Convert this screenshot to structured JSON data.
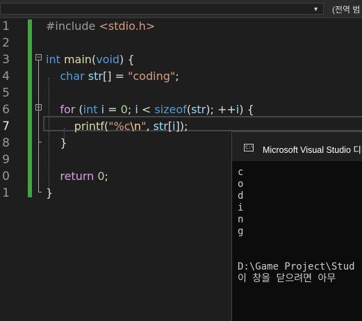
{
  "toolbar": {
    "scope_dropdown_value": "",
    "member_scope_label": "(전역 범"
  },
  "editor": {
    "line_numbers": [
      "1",
      "2",
      "3",
      "4",
      "5",
      "6",
      "7",
      "8",
      "9",
      "0",
      "1"
    ],
    "active_line_index": 6,
    "lines": [
      {
        "tokens": [
          {
            "t": "#include ",
            "c": "pre"
          },
          {
            "t": "<stdio.h>",
            "c": "str"
          }
        ]
      },
      {
        "tokens": []
      },
      {
        "tokens": [
          {
            "t": "int",
            "c": "kw"
          },
          {
            "t": " ",
            "c": "op"
          },
          {
            "t": "main",
            "c": "fn"
          },
          {
            "t": "(",
            "c": "op"
          },
          {
            "t": "void",
            "c": "kw"
          },
          {
            "t": ") {",
            "c": "op"
          }
        ]
      },
      {
        "tokens": [
          {
            "t": "    ",
            "c": "op"
          },
          {
            "t": "char",
            "c": "kw"
          },
          {
            "t": " ",
            "c": "op"
          },
          {
            "t": "str",
            "c": "id"
          },
          {
            "t": "[] = ",
            "c": "op"
          },
          {
            "t": "\"coding\"",
            "c": "str"
          },
          {
            "t": ";",
            "c": "op"
          }
        ]
      },
      {
        "tokens": []
      },
      {
        "tokens": [
          {
            "t": "    ",
            "c": "op"
          },
          {
            "t": "for",
            "c": "ctl"
          },
          {
            "t": " (",
            "c": "op"
          },
          {
            "t": "int",
            "c": "kw"
          },
          {
            "t": " ",
            "c": "op"
          },
          {
            "t": "i",
            "c": "id"
          },
          {
            "t": " = ",
            "c": "op"
          },
          {
            "t": "0",
            "c": "num"
          },
          {
            "t": "; ",
            "c": "op"
          },
          {
            "t": "i",
            "c": "id"
          },
          {
            "t": " < ",
            "c": "op"
          },
          {
            "t": "sizeof",
            "c": "kw"
          },
          {
            "t": "(",
            "c": "op"
          },
          {
            "t": "str",
            "c": "id"
          },
          {
            "t": "); ++",
            "c": "op"
          },
          {
            "t": "i",
            "c": "id"
          },
          {
            "t": ") {",
            "c": "op"
          }
        ]
      },
      {
        "tokens": [
          {
            "t": "        ",
            "c": "op"
          },
          {
            "t": "printf",
            "c": "fn"
          },
          {
            "t": "(",
            "c": "op"
          },
          {
            "t": "\"%c",
            "c": "str"
          },
          {
            "t": "\\n",
            "c": "esc"
          },
          {
            "t": "\"",
            "c": "str"
          },
          {
            "t": ", ",
            "c": "op"
          },
          {
            "t": "str",
            "c": "id"
          },
          {
            "t": "[",
            "c": "op"
          },
          {
            "t": "i",
            "c": "id"
          },
          {
            "t": "]);",
            "c": "op"
          }
        ]
      },
      {
        "tokens": [
          {
            "t": "    }",
            "c": "op"
          }
        ]
      },
      {
        "tokens": []
      },
      {
        "tokens": [
          {
            "t": "    ",
            "c": "op"
          },
          {
            "t": "return",
            "c": "ctl"
          },
          {
            "t": " ",
            "c": "op"
          },
          {
            "t": "0",
            "c": "num"
          },
          {
            "t": ";",
            "c": "op"
          }
        ]
      },
      {
        "tokens": [
          {
            "t": "}",
            "c": "op"
          }
        ]
      }
    ]
  },
  "console": {
    "title": "Microsoft Visual Studio 디버",
    "icon_label": "C:\\",
    "output_lines": [
      "c",
      "o",
      "d",
      "i",
      "n",
      "g",
      "",
      "",
      "D:\\Game Project\\Stud",
      "이 창을 닫으려면 아무"
    ]
  },
  "colors": {
    "change_bar": "#45a345",
    "keyword": "#569cd6",
    "control": "#d8a0df",
    "function": "#dcdcaa",
    "string": "#d69d85",
    "number": "#b5cea8",
    "identifier": "#9cdcfe"
  }
}
